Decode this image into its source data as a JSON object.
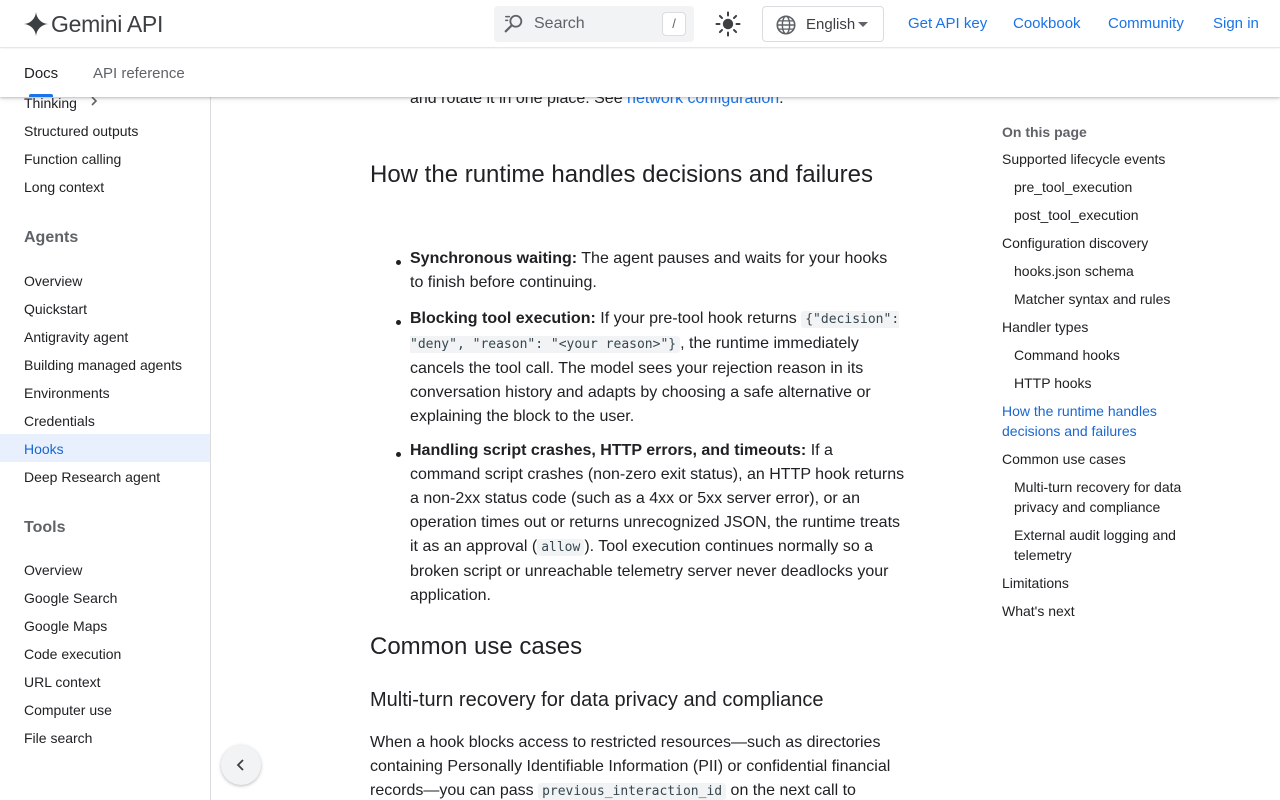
{
  "header": {
    "logo_text": "Gemini API",
    "search_placeholder": "Search",
    "search_shortcut": "/",
    "language": "English",
    "links": [
      "Get API key",
      "Cookbook",
      "Community",
      "Sign in"
    ]
  },
  "tabs": [
    "Docs",
    "API reference"
  ],
  "sidebar": {
    "top_items": [
      "Thinking",
      "Structured outputs",
      "Function calling",
      "Long context"
    ],
    "agents_heading": "Agents",
    "agents_items": [
      "Overview",
      "Quickstart",
      "Antigravity agent",
      "Building managed agents",
      "Environments",
      "Credentials",
      "Hooks",
      "Deep Research agent"
    ],
    "active_item": "Hooks",
    "tools_heading": "Tools",
    "tools_items": [
      "Overview",
      "Google Search",
      "Google Maps",
      "Code execution",
      "URL context",
      "Computer use",
      "File search"
    ]
  },
  "content": {
    "intro_text": "and rotate it in one place. See ",
    "intro_link": "network configuration",
    "intro_end": ".",
    "h2_runtime": "How the runtime handles decisions and failures",
    "b1_title": "Synchronous waiting:",
    "b1_text": " The agent pauses and waits for your hooks to finish before continuing.",
    "b2_title": "Blocking tool execution:",
    "b2_text_a": " If your pre-tool hook returns ",
    "b2_code": "{\"decision\": \"deny\", \"reason\": \"<your reason>\"}",
    "b2_text_b": ", the runtime immediately cancels the tool call. The model sees your rejection reason in its conversation history and adapts by choosing a safe alternative or explaining the block to the user.",
    "b3_title": "Handling script crashes, HTTP errors, and timeouts:",
    "b3_text_a": " If a command script crashes (non-zero exit status), an HTTP hook returns a non-2xx status code (such as a 4xx or 5xx server error), or an operation times out or returns unrecognized JSON, the runtime treats it as an approval (",
    "b3_code": "allow",
    "b3_text_b": "). Tool execution continues normally so a broken script or unreachable telemetry server never deadlocks your application.",
    "h2_common": "Common use cases",
    "h3_multiturn": "Multi-turn recovery for data privacy and compliance",
    "para_a": "When a hook blocks access to restricted resources—such as directories containing Personally Identifiable Information (PII) or confidential financial records—you can pass ",
    "para_code": "previous_interaction_id",
    "para_b": " on the next call to"
  },
  "toc": {
    "title": "On this page",
    "items": [
      {
        "label": "Supported lifecycle events",
        "level": 1
      },
      {
        "label": "pre_tool_execution",
        "level": 2
      },
      {
        "label": "post_tool_execution",
        "level": 2
      },
      {
        "label": "Configuration discovery",
        "level": 1
      },
      {
        "label": "hooks.json schema",
        "level": 2
      },
      {
        "label": "Matcher syntax and rules",
        "level": 2
      },
      {
        "label": "Handler types",
        "level": 1
      },
      {
        "label": "Command hooks",
        "level": 2
      },
      {
        "label": "HTTP hooks",
        "level": 2
      },
      {
        "label": "How the runtime handles decisions and failures",
        "level": 1,
        "active": true
      },
      {
        "label": "Common use cases",
        "level": 1
      },
      {
        "label": "Multi-turn recovery for data privacy and compliance",
        "level": 2
      },
      {
        "label": "External audit logging and telemetry",
        "level": 2
      },
      {
        "label": "Limitations",
        "level": 1
      },
      {
        "label": "What's next",
        "level": 1
      }
    ]
  },
  "colors": {
    "accent": "#1a73e8",
    "active_text": "#1967d2",
    "active_bg": "#e8f0fe"
  }
}
